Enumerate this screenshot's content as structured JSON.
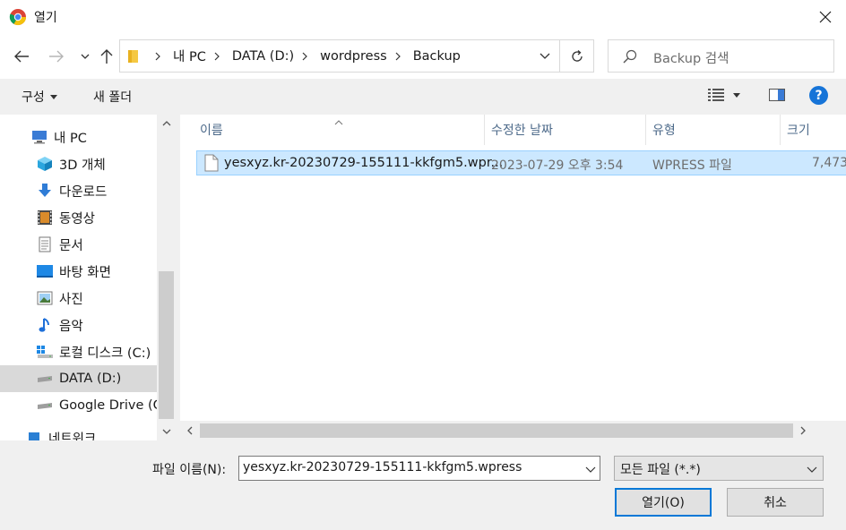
{
  "window": {
    "title": "열기"
  },
  "address": {
    "crumbs": [
      "내 PC",
      "DATA (D:)",
      "wordpress",
      "Backup"
    ]
  },
  "search": {
    "placeholder": "Backup 검색"
  },
  "toolbar": {
    "organize_label": "구성",
    "new_folder_label": "새 폴더",
    "help_label": "?"
  },
  "sidebar": {
    "items": [
      {
        "label": "내 PC",
        "icon": "pc-icon"
      },
      {
        "label": "3D 개체",
        "icon": "cube-icon"
      },
      {
        "label": "다운로드",
        "icon": "download-arrow-icon"
      },
      {
        "label": "동영상",
        "icon": "film-icon"
      },
      {
        "label": "문서",
        "icon": "document-icon"
      },
      {
        "label": "바탕 화면",
        "icon": "desktop-icon"
      },
      {
        "label": "사진",
        "icon": "picture-icon"
      },
      {
        "label": "음악",
        "icon": "music-note-icon"
      },
      {
        "label": "로컬 디스크 (C:)",
        "icon": "windows-drive-icon"
      },
      {
        "label": "DATA (D:)",
        "icon": "drive-icon",
        "selected": true
      },
      {
        "label": "Google Drive (G:)",
        "icon": "drive-icon"
      },
      {
        "label": "네트워크",
        "icon": "network-icon"
      }
    ]
  },
  "columns": {
    "name": "이름",
    "date": "수정한 날짜",
    "type": "유형",
    "size": "크기"
  },
  "files": [
    {
      "name": "yesxyz.kr-20230729-155111-kkfgm5.wpr...",
      "date": "2023-07-29 오후 3:54",
      "type": "WPRESS 파일",
      "size": "7,473"
    }
  ],
  "bottom": {
    "filename_label": "파일 이름(N):",
    "filename_value": "yesxyz.kr-20230729-155111-kkfgm5.wpress",
    "filetype_value": "모든 파일 (*.*)",
    "open_label": "열기(O)",
    "cancel_label": "취소"
  },
  "colors": {
    "accent": "#0078d7",
    "selection": "#cce8ff",
    "selection_border": "#99d1ff",
    "help": "#1674d8"
  }
}
